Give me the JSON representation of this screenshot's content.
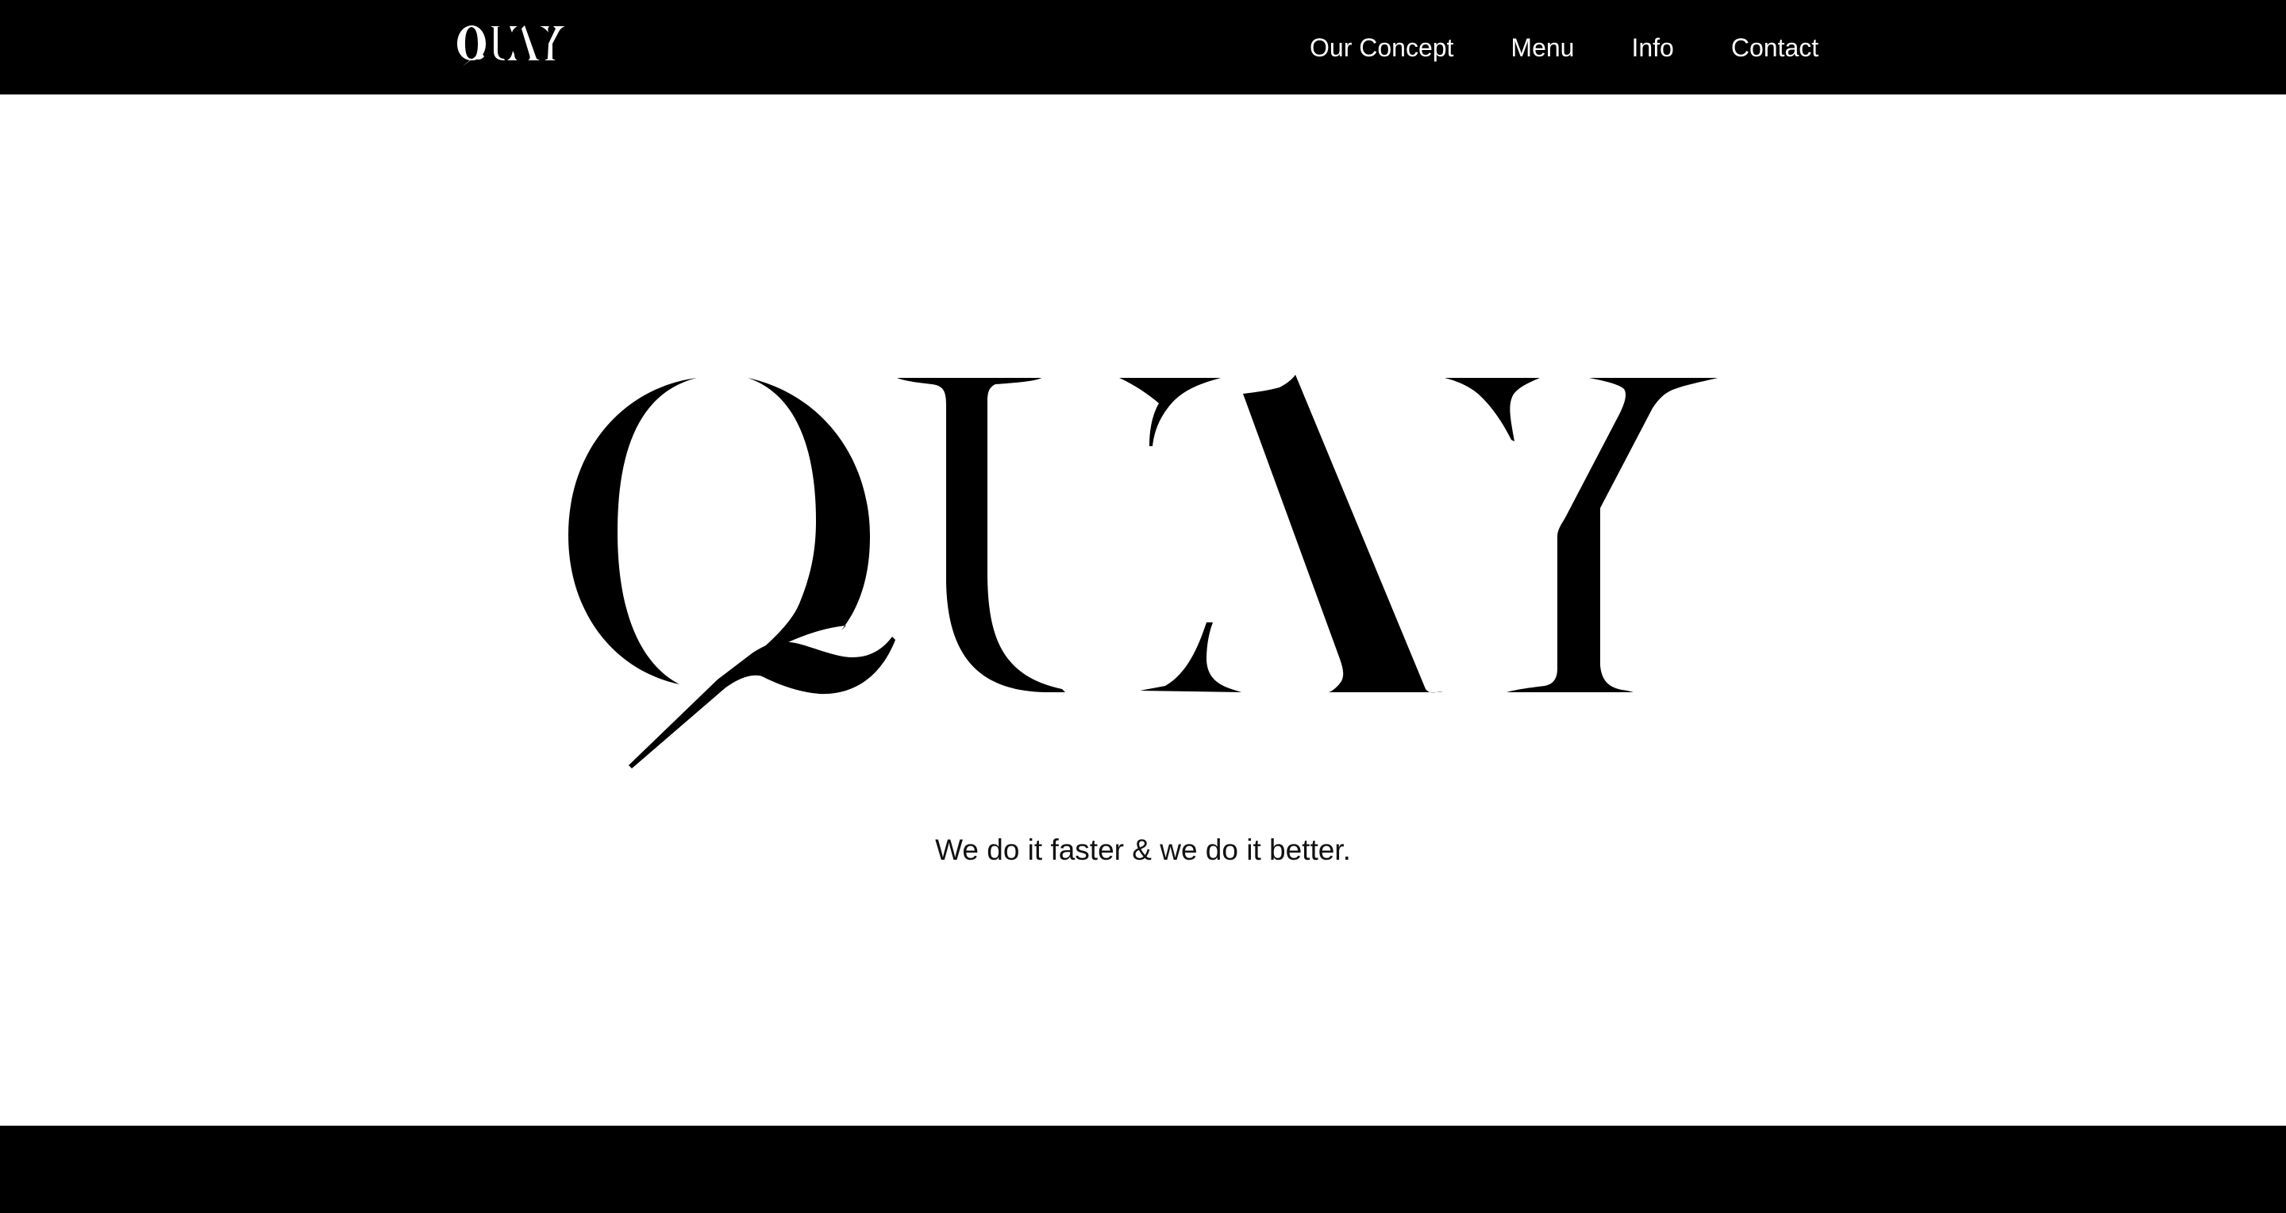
{
  "brand": {
    "logo_text": "QUAY",
    "colors": {
      "bar": "#000000",
      "background": "#ffffff",
      "nav_text": "#ffffff",
      "logo_ink": "#000000"
    }
  },
  "nav": {
    "items": [
      {
        "label": "Our Concept"
      },
      {
        "label": "Menu"
      },
      {
        "label": "Info"
      },
      {
        "label": "Contact"
      }
    ]
  },
  "hero": {
    "logo_text": "QUAY",
    "tagline": "We do it faster & we do it better."
  }
}
